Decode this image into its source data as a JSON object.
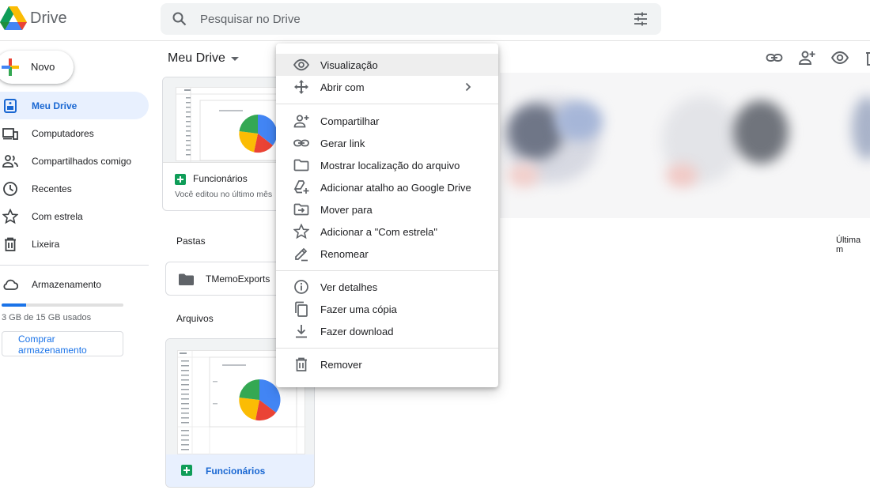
{
  "app": {
    "name": "Drive",
    "logo_icon": "google-drive-logo-icon"
  },
  "search": {
    "placeholder": "Pesquisar no Drive",
    "icon": "search-icon",
    "options_icon": "tune-icon"
  },
  "new_button": {
    "label": "Novo",
    "icon": "plus-icon"
  },
  "sidebar": {
    "items": [
      {
        "label": "Meu Drive",
        "icon": "my-drive-icon",
        "active": true
      },
      {
        "label": "Computadores",
        "icon": "computers-icon",
        "active": false
      },
      {
        "label": "Compartilhados comigo",
        "icon": "people-icon",
        "active": false
      },
      {
        "label": "Recentes",
        "icon": "clock-icon",
        "active": false
      },
      {
        "label": "Com estrela",
        "icon": "star-icon",
        "active": false
      },
      {
        "label": "Lixeira",
        "icon": "trash-icon",
        "active": false
      }
    ],
    "storage": {
      "label": "Armazenamento",
      "icon": "cloud-icon",
      "usage_text": "3 GB de 15 GB usados",
      "used_fraction": 0.2,
      "buy_label": "Comprar armazenamento"
    }
  },
  "main": {
    "title": "Meu Drive",
    "suggested": {
      "name": "Funcionários",
      "subtitle": "Você editou no último mês"
    },
    "folders_label": "Pastas",
    "files_label": "Arquivos",
    "sort_label": "Última m",
    "folders": [
      {
        "name": "TMemoExports"
      }
    ],
    "files": [
      {
        "name": "Funcionários",
        "selected": true
      }
    ]
  },
  "context_menu": {
    "groups": [
      [
        {
          "label": "Visualização",
          "icon": "eye-icon",
          "hover": true
        },
        {
          "label": "Abrir com",
          "icon": "move-arrows-icon",
          "submenu": true
        }
      ],
      [
        {
          "label": "Compartilhar",
          "icon": "person-add-icon"
        },
        {
          "label": "Gerar link",
          "icon": "link-icon"
        },
        {
          "label": "Mostrar localização do arquivo",
          "icon": "folder-outline-icon"
        },
        {
          "label": "Adicionar atalho ao Google Drive",
          "icon": "drive-add-icon"
        },
        {
          "label": "Mover para",
          "icon": "move-to-folder-icon"
        },
        {
          "label": "Adicionar a \"Com estrela\"",
          "icon": "star-outline-icon"
        },
        {
          "label": "Renomear",
          "icon": "pencil-icon"
        }
      ],
      [
        {
          "label": "Ver detalhes",
          "icon": "info-icon"
        },
        {
          "label": "Fazer uma cópia",
          "icon": "copy-icon"
        },
        {
          "label": "Fazer download",
          "icon": "download-icon"
        }
      ],
      [
        {
          "label": "Remover",
          "icon": "trash-icon"
        }
      ]
    ]
  },
  "colors": {
    "accent": "#1a73e8",
    "active_bg": "#e8f0fe",
    "sheets_green": "#0f9d58"
  }
}
